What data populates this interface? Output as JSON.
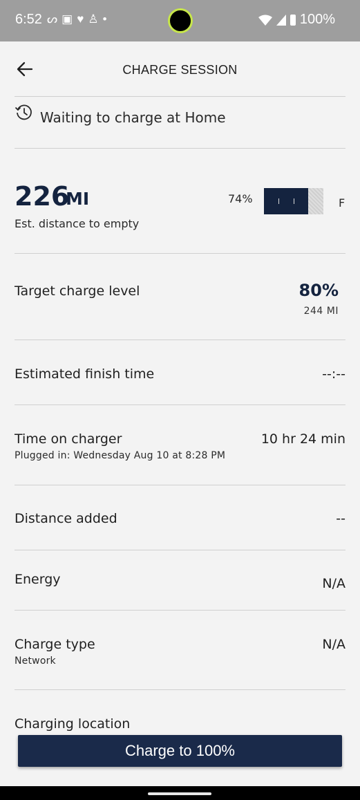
{
  "status_bar": {
    "time": "6:52",
    "battery": "100%",
    "left_icons": [
      "voicemail-icon",
      "teams-icon",
      "health-icon",
      "accessibility-icon",
      "dot-icon"
    ],
    "right_icons": [
      "wifi-icon",
      "signal-icon",
      "battery-icon"
    ]
  },
  "header": {
    "title": "CHARGE SESSION",
    "back_icon": "arrow-left-icon"
  },
  "session_status": {
    "icon": "history-icon",
    "text": "Waiting to charge at Home"
  },
  "range": {
    "value": "226",
    "unit": "MI",
    "caption": "Est. distance to empty",
    "battery_percent": "74%",
    "battery_level": 0.74,
    "full_label": "F"
  },
  "rows": {
    "target": {
      "label": "Target charge level",
      "value": "80%",
      "sub": "244 MI"
    },
    "finish_time": {
      "label": "Estimated finish time",
      "value": "--:--"
    },
    "time_on_charger": {
      "label": "Time on charger",
      "value": "10 hr 24 min",
      "sub": "Plugged in: Wednesday Aug 10 at 8:28 PM"
    },
    "distance_added": {
      "label": "Distance added",
      "value": "--"
    },
    "energy": {
      "label": "Energy",
      "value": "N/A"
    },
    "charge_type": {
      "label": "Charge type",
      "value": "N/A",
      "sub": "Network"
    },
    "charging_location": {
      "label": "Charging location"
    }
  },
  "cta": {
    "label": "Charge to 100%"
  },
  "colors": {
    "brand_navy": "#14233f",
    "button_navy": "#1a2a4a",
    "background": "#f3f3f3",
    "status_bar": "#9e9e9e"
  }
}
